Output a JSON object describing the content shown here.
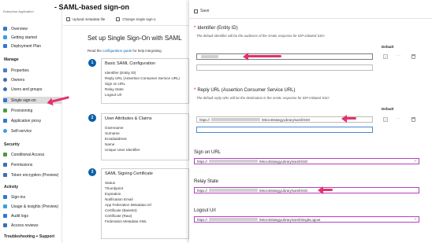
{
  "sidebar": {
    "header": "Enterprise Application",
    "items_top": [
      {
        "label": "Overview",
        "color": "#2b79d4"
      },
      {
        "label": "Getting started",
        "color": "#3aa0e0"
      },
      {
        "label": "Deployment Plan",
        "color": "#2b79d4"
      }
    ],
    "sections": [
      {
        "title": "Manage",
        "items": [
          {
            "label": "Properties",
            "color": "#4a7fc1"
          },
          {
            "label": "Owners",
            "color": "#3c6fb4"
          },
          {
            "label": "Users and groups",
            "color": "#3c6fb4"
          },
          {
            "label": "Single sign-on",
            "color": "#2b79d4",
            "selected": true
          },
          {
            "label": "Provisioning",
            "color": "#49a048"
          },
          {
            "label": "Application proxy",
            "color": "#2b79d4"
          },
          {
            "label": "Self-service",
            "color": "#3aa0e0"
          }
        ]
      },
      {
        "title": "Security",
        "items": [
          {
            "label": "Conditional Access",
            "color": "#4a9a3a"
          },
          {
            "label": "Permissions",
            "color": "#3c6fb4"
          },
          {
            "label": "Token encryption (Preview)",
            "color": "#3c6fb4"
          }
        ]
      },
      {
        "title": "Activity",
        "items": [
          {
            "label": "Sign-ins",
            "color": "#2b79d4"
          },
          {
            "label": "Usage & insights (Preview)",
            "color": "#3aa0e0"
          },
          {
            "label": "Audit logs",
            "color": "#2b79d4"
          },
          {
            "label": "Access reviews",
            "color": "#3c6fb4"
          }
        ]
      },
      {
        "title": "Troubleshooting + Support",
        "items": []
      }
    ]
  },
  "blade": {
    "title": "- SAML-based sign-on",
    "upload_label": "Upload metadata file",
    "change_label": "Change single sign-o",
    "setup_heading": "Set up Single Sign-On with SAML",
    "setup_desc_prefix": "Read the ",
    "setup_desc_link": "configuration guide",
    "setup_desc_suffix": " for help integrating",
    "steps": [
      {
        "num": "1",
        "title": "Basic SAML Configuration",
        "lines": [
          "Identifier (Entity ID)",
          "Reply URL (Assertion Consumer Service URL)",
          "Sign on URL",
          "Relay State",
          "Logout Url"
        ]
      },
      {
        "num": "2",
        "title": "User Attributes & Claims",
        "lines": [
          "Givenname",
          "Surname",
          "Emailaddress",
          "Name",
          "Unique User Identifier"
        ]
      },
      {
        "num": "3",
        "title": "SAML Signing Certificate",
        "lines": [
          "Status",
          "Thumbprint",
          "Expiration",
          "Notification Email",
          "App Federation Metadata Url",
          "Certificate (Base64)",
          "Certificate (Raw)",
          "Federation Metadata XML"
        ]
      }
    ]
  },
  "panel": {
    "save_label": "Save",
    "identifier": {
      "label": "Identifier (Entity ID)",
      "required": "*",
      "hint": "The default identifier will be the audience of the SAML response for IDP-initiated SSO",
      "default_header": "Default"
    },
    "reply_url": {
      "label": "Reply URL (Assertion Consumer Service URL)",
      "required": "*",
      "hint": "The default reply URL will be the destination in the SAML response for IDP-initiated SSO",
      "default_header": "Default",
      "value_prefix": "https://",
      "value_suffix": "/MicroStrategyLibrary/saml/SSO"
    },
    "sign_on": {
      "label": "Sign on URL",
      "value_prefix": "https://",
      "value_suffix": "/MicroStrategyLibrary/saml/SSO"
    },
    "relay_state": {
      "label": "Relay State",
      "value_prefix": "https://",
      "value_suffix": "/MicroStrategyLibrary/saml/SSO"
    },
    "logout": {
      "label": "Logout Url",
      "value_prefix": "https://",
      "value_suffix": "/MicroStrategyLibrary/saml/SingleLogout"
    }
  },
  "colors": {
    "accent": "#0b5fa8",
    "arrow": "#e5306e",
    "highlight_border": "#b53fc2",
    "required": "#c00000"
  }
}
